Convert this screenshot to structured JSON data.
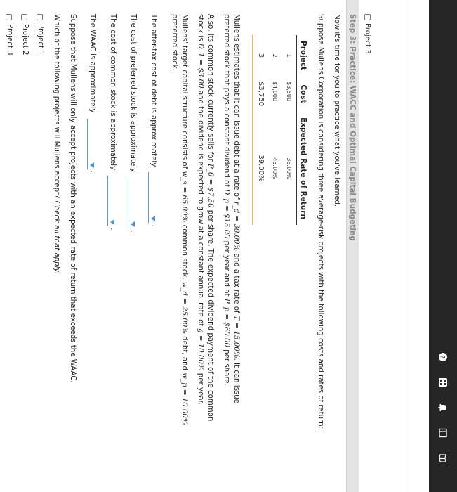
{
  "taskbar": {
    "icons": [
      "sidebar-icon",
      "bell-icon",
      "calculator-icon",
      "help-icon",
      "book-icon"
    ]
  },
  "previous_item": "Project 3",
  "step_header": "Step 3: Practice: WACC and Optimal Capital Budgeting",
  "intro": "Now it's time for you to practice what you've learned.",
  "scenario": "Suppose Mullens Corporation is considering three average-risk projects with the following costs and rates of return:",
  "table": {
    "headers": [
      "Project",
      "Cost",
      "Expected Rate of Return"
    ],
    "rows": [
      [
        "1",
        "$3,500",
        "38.00%"
      ],
      [
        "2",
        "$4,000",
        "45.00%"
      ],
      [
        "3",
        "$3,750",
        "39.00%"
      ]
    ]
  },
  "debt_paragraph": {
    "part1": "Mullens estimates that it can issue debt at a rate of ",
    "rd": "r_d = 30.00%",
    "part2": " and a tax rate of ",
    "t": "T = 15.00%",
    "part3": ". It can issue preferred stock that pays a constant dividend of ",
    "dp": "D_p = $15.00",
    "part4": " per year and at ",
    "pp": "P_p = $60.00",
    "part5": " per share."
  },
  "common_paragraph": {
    "part1": "Also, its common stock currently sells for ",
    "p0": "P_0 = $7.50",
    "part2": " per share. The expected dividend payment of the common stock is ",
    "d1": "D_1 = $3.00",
    "part3": " and the dividend is expected to grow at a constant annual rate of ",
    "g": "g = 10.00%",
    "part4": " per year."
  },
  "structure_paragraph": {
    "part1": "Mullens' target capital structure consists of ",
    "ws": "w_s = 65.00%",
    "part2": " common stock, ",
    "wd": "w_d = 25.00%",
    "part3": " debt, and ",
    "wp": "w_p = 10.00%",
    "part4": " preferred stock."
  },
  "questions": [
    {
      "label": "The after-tax cost of debt is approximately",
      "punct": "."
    },
    {
      "label": "The cost of preferred stock is approximately",
      "punct": "."
    },
    {
      "label": "The cost of common stock is approximately",
      "punct": "."
    },
    {
      "label": "The WAAC is approximately",
      "punct": "."
    }
  ],
  "accept_statement": "Suppose that Mullens will only accept projects with an expected rate of return that exceeds the WAAC.",
  "question_prompt": "Which of the following projects will Mullens accept?",
  "question_hint": "Check all that apply.",
  "options": [
    "Project 1",
    "Project 2",
    "Project 3"
  ]
}
